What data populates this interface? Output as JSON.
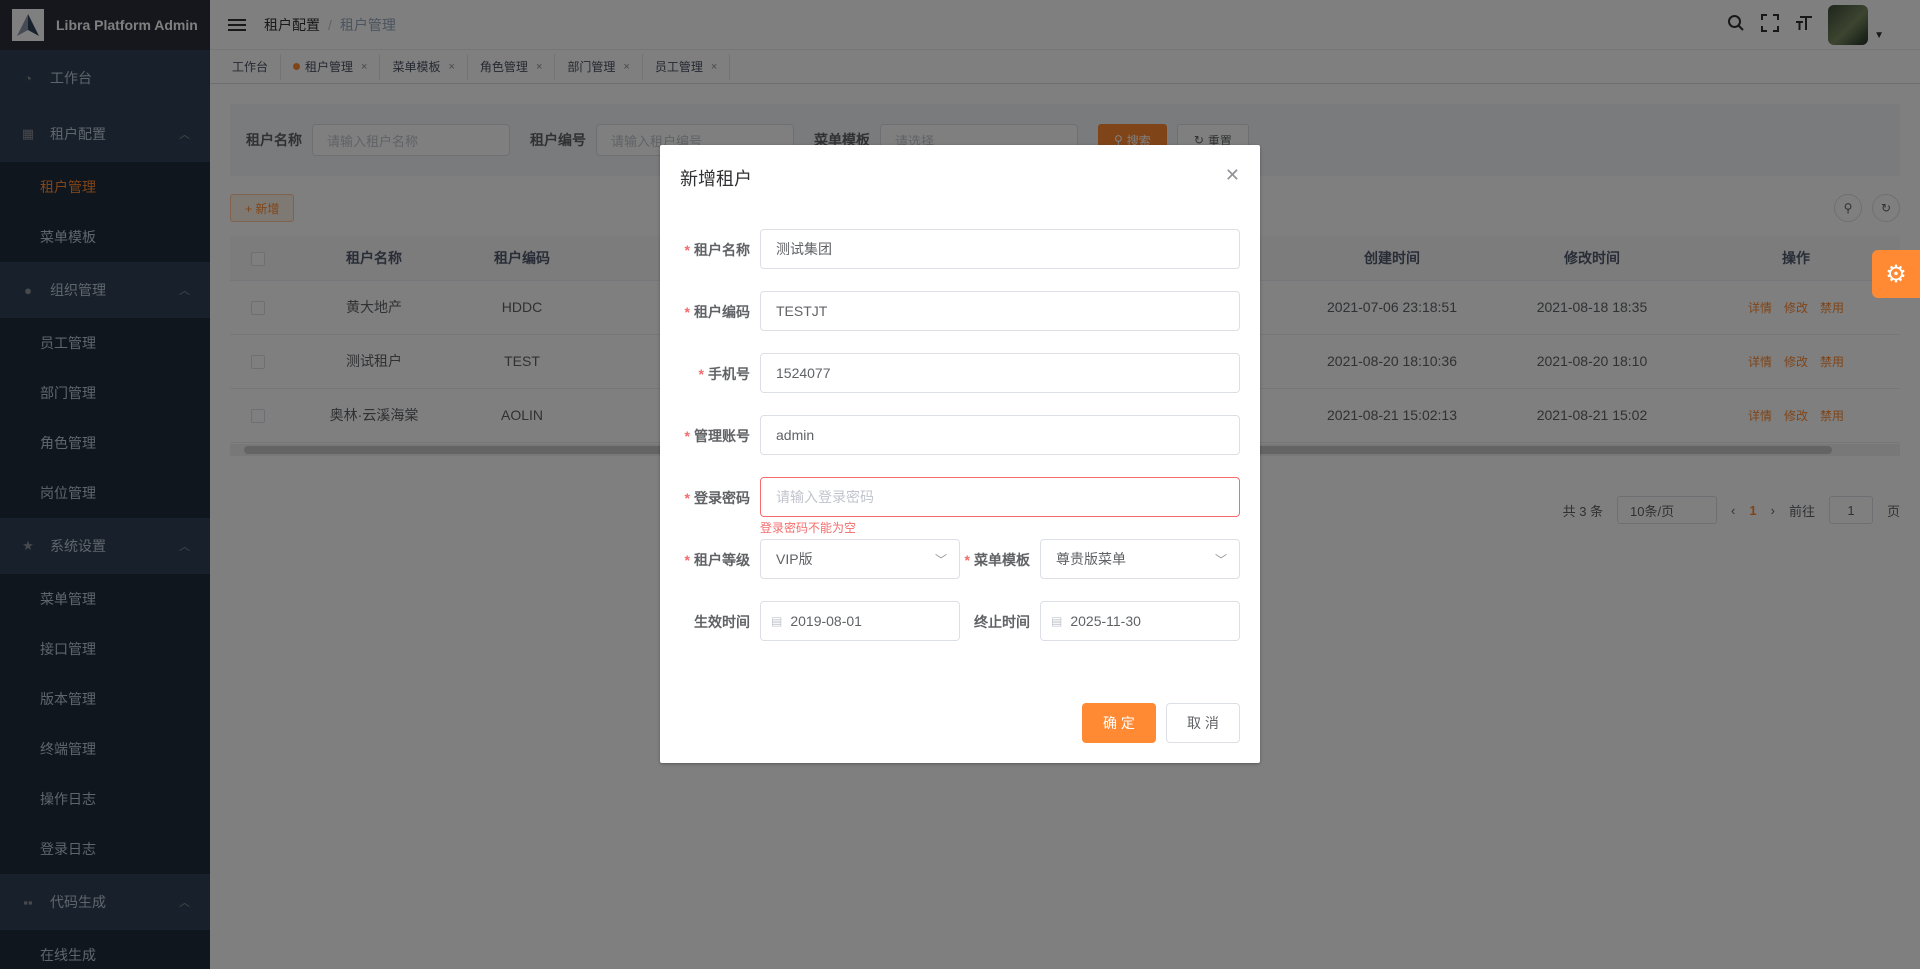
{
  "app": {
    "title": "Libra Platform Admin"
  },
  "sidebar": {
    "workbench": "工作台",
    "tenant_group": "租户配置",
    "tenant_items": [
      "租户管理",
      "菜单模板"
    ],
    "org_group": "组织管理",
    "org_items": [
      "员工管理",
      "部门管理",
      "角色管理",
      "岗位管理"
    ],
    "sys_group": "系统设置",
    "sys_items": [
      "菜单管理",
      "接口管理",
      "版本管理",
      "终端管理",
      "操作日志",
      "登录日志"
    ],
    "code_group": "代码生成",
    "code_items": [
      "在线生成"
    ]
  },
  "breadcrumb": {
    "parent": "租户配置",
    "sep": "/",
    "current": "租户管理"
  },
  "tags": [
    "工作台",
    "租户管理",
    "菜单模板",
    "角色管理",
    "部门管理",
    "员工管理"
  ],
  "search": {
    "name_label": "租户名称",
    "name_placeholder": "请输入租户名称",
    "code_label": "租户编号",
    "code_placeholder": "请输入租户编号",
    "tpl_label": "菜单模板",
    "tpl_placeholder": "请选择",
    "search_btn": "搜索",
    "reset_btn": "重置"
  },
  "toolbar": {
    "add": "+ 新增"
  },
  "table": {
    "headers": [
      "租户名称",
      "租户编码",
      "创建时间",
      "修改时间",
      "操作"
    ],
    "rows": [
      {
        "name": "黄大地产",
        "code": "HDDC",
        "partial": "2021-0",
        "created": "2021-07-06 23:18:51",
        "modified": "2021-08-18 18:35"
      },
      {
        "name": "测试租户",
        "code": "TEST",
        "partial": "2021-0",
        "created": "2021-08-20 18:10:36",
        "modified": "2021-08-20 18:10"
      },
      {
        "name": "奥林·云溪海棠",
        "code": "AOLIN",
        "partial": "2021-0",
        "created": "2021-08-21 15:02:13",
        "modified": "2021-08-21 15:02"
      }
    ],
    "ops": {
      "detail": "详情",
      "edit": "修改",
      "disable": "禁用"
    }
  },
  "pager": {
    "total": "共 3 条",
    "size": "10条/页",
    "current": "1",
    "goto": "前往",
    "goto_value": "1",
    "page_unit": "页"
  },
  "modal": {
    "title": "新增租户",
    "tenant_name_label": "租户名称",
    "tenant_name_value": "测试集团",
    "tenant_code_label": "租户编码",
    "tenant_code_value": "TESTJT",
    "phone_label": "手机号",
    "phone_value": "1524077",
    "account_label": "管理账号",
    "account_value": "admin",
    "password_label": "登录密码",
    "password_placeholder": "请输入登录密码",
    "password_error": "登录密码不能为空",
    "level_label": "租户等级",
    "level_value": "VIP版",
    "template_label": "菜单模板",
    "template_value": "尊贵版菜单",
    "start_label": "生效时间",
    "start_value": "2019-08-01",
    "end_label": "终止时间",
    "end_value": "2025-11-30",
    "ok": "确 定",
    "cancel": "取 消"
  },
  "colors": {
    "accent": "#ff8a33",
    "sidebar": "#304156",
    "error": "#f56c6c"
  }
}
